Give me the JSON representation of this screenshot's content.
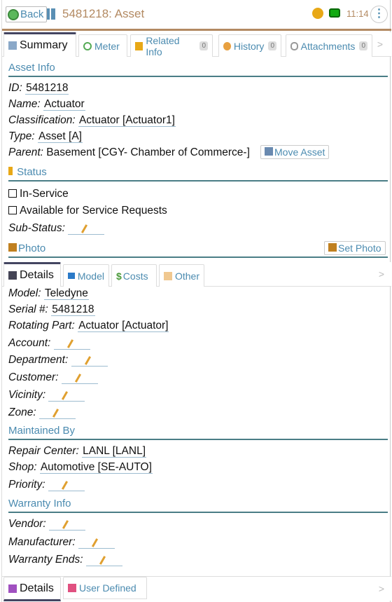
{
  "header": {
    "back_label": "Back",
    "title": "5481218: Asset",
    "time": "11:14"
  },
  "top_tabs": [
    {
      "label": "Summary"
    },
    {
      "label": "Meter"
    },
    {
      "label": "Related Info",
      "count": "0"
    },
    {
      "label": "History",
      "count": "0"
    },
    {
      "label": "Attachments",
      "count": "0"
    }
  ],
  "chevron": ">",
  "asset_info": {
    "title": "Asset Info",
    "fields": [
      {
        "label": "ID:",
        "value": "5481218"
      },
      {
        "label": "Name:",
        "value": "Actuator"
      },
      {
        "label": "Classification:",
        "value": "Actuator [Actuator1]"
      },
      {
        "label": "Type:",
        "value": "Asset [A]"
      },
      {
        "label": "Parent:",
        "value": "Basement [CGY- Chamber of Commerce-]"
      }
    ],
    "move_asset_label": "Move Asset"
  },
  "status": {
    "title": "Status",
    "in_service": "In-Service",
    "available": "Available for Service Requests",
    "sub_status_label": "Sub-Status:"
  },
  "photo": {
    "title": "Photo",
    "set_photo_label": "Set Photo"
  },
  "detail_tabs": [
    {
      "label": "Details"
    },
    {
      "label": "Model"
    },
    {
      "label": "Costs"
    },
    {
      "label": "Other"
    }
  ],
  "details": {
    "fields": [
      {
        "label": "Model:",
        "value": "Teledyne"
      },
      {
        "label": "Serial #:",
        "value": "5481218"
      },
      {
        "label": "Rotating Part:",
        "value": "Actuator [Actuator]"
      },
      {
        "label": "Account:",
        "value": ""
      },
      {
        "label": "Department:",
        "value": ""
      },
      {
        "label": "Customer:",
        "value": ""
      },
      {
        "label": "Vicinity:",
        "value": ""
      },
      {
        "label": "Zone:",
        "value": ""
      }
    ]
  },
  "maintained_by": {
    "title": "Maintained By",
    "fields": [
      {
        "label": "Repair Center:",
        "value": "LANL [LANL]"
      },
      {
        "label": "Shop:",
        "value": "Automotive [SE-AUTO]"
      },
      {
        "label": "Priority:",
        "value": ""
      }
    ]
  },
  "warranty": {
    "title": "Warranty Info",
    "fields": [
      {
        "label": "Vendor:",
        "value": ""
      },
      {
        "label": "Manufacturer:",
        "value": ""
      },
      {
        "label": "Warranty Ends:",
        "value": ""
      }
    ]
  },
  "bottom_tabs": [
    {
      "label": "Details"
    },
    {
      "label": "User Defined"
    }
  ]
}
